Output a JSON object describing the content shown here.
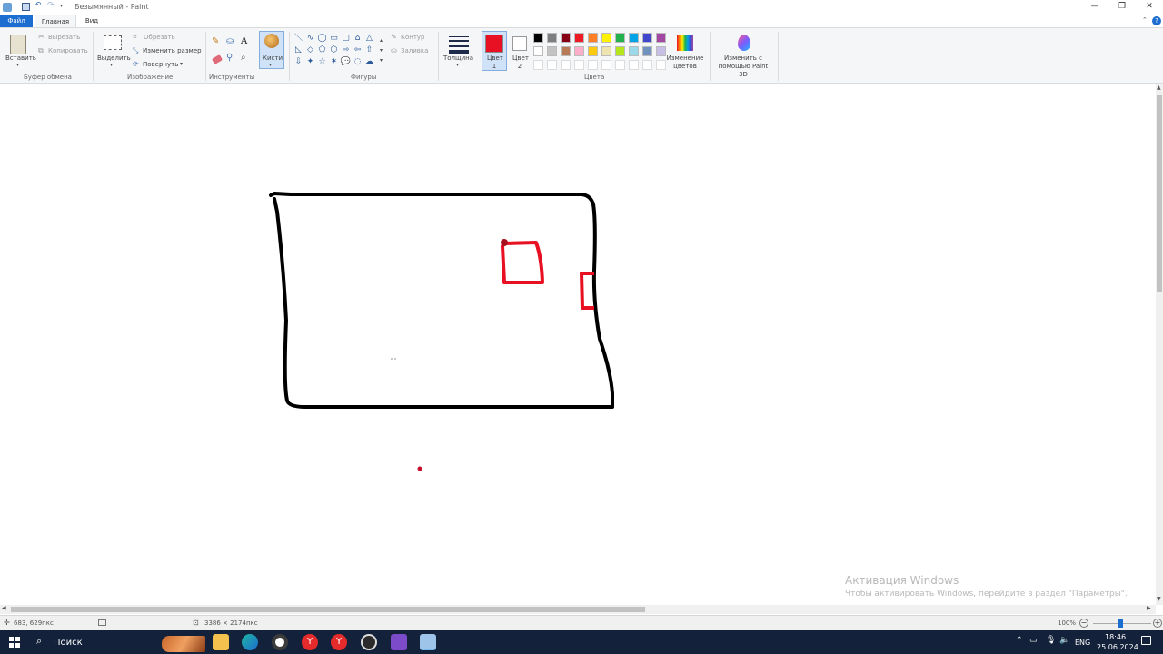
{
  "window": {
    "title": "Безымянный - Paint",
    "minimize": "—",
    "maximize": "❐",
    "close": "✕"
  },
  "tabs": [
    {
      "label": "Файл"
    },
    {
      "label": "Главная"
    },
    {
      "label": "Вид"
    }
  ],
  "ribbon": {
    "clipboard": {
      "paste": "Вставить",
      "cut": "Вырезать",
      "copy": "Копировать",
      "group": "Буфер обмена"
    },
    "image": {
      "select": "Выделить",
      "crop": "Обрезать",
      "resize": "Изменить размер",
      "rotate": "Повернуть",
      "group": "Изображение"
    },
    "tools": {
      "brushes": "Кисти",
      "text_tool": "A",
      "group": "Инструменты"
    },
    "shapes": {
      "outline": "Контур",
      "fill": "Заливка",
      "group": "Фигуры",
      "glyphs": [
        "＼",
        "∿",
        "◯",
        "▭",
        "▢",
        "⌂",
        "△",
        "◺",
        "◇",
        "⬠",
        "⬡",
        "⇨",
        "⇦",
        "⇧",
        "⇩",
        "✦",
        "☆",
        "✶",
        "💬",
        "◌",
        "☁"
      ]
    },
    "size": {
      "label": "Толщина"
    },
    "colors": {
      "color1": "Цвет 1",
      "color2": "Цвет 2",
      "edit": "Изменение цветов",
      "group": "Цвета",
      "color1_value": "#e81123",
      "color2_value": "#ffffff",
      "palette": [
        "#000000",
        "#7f7f7f",
        "#880015",
        "#ed1c24",
        "#ff7f27",
        "#fff200",
        "#22b14c",
        "#00a2e8",
        "#3f48cc",
        "#a349a4",
        "#ffffff",
        "#c3c3c3",
        "#b97a57",
        "#ffaec9",
        "#ffc90e",
        "#efe4b0",
        "#b5e61d",
        "#99d9ea",
        "#7092be",
        "#c8bfe7"
      ]
    },
    "paint3d": {
      "label": "Изменить с помощью Paint 3D"
    }
  },
  "status": {
    "cursor_pos": "683, 629пкс",
    "canvas_size": "3386 × 2174пкс",
    "zoom": "100%",
    "zoom_level": 1.0
  },
  "watermark": {
    "title": "Активация Windows",
    "subtitle": "Чтобы активировать Windows, перейдите в раздел \"Параметры\"."
  },
  "taskbar": {
    "search": "Поиск",
    "lang": "ENG",
    "time": "18:46",
    "date": "25.06.2024"
  }
}
